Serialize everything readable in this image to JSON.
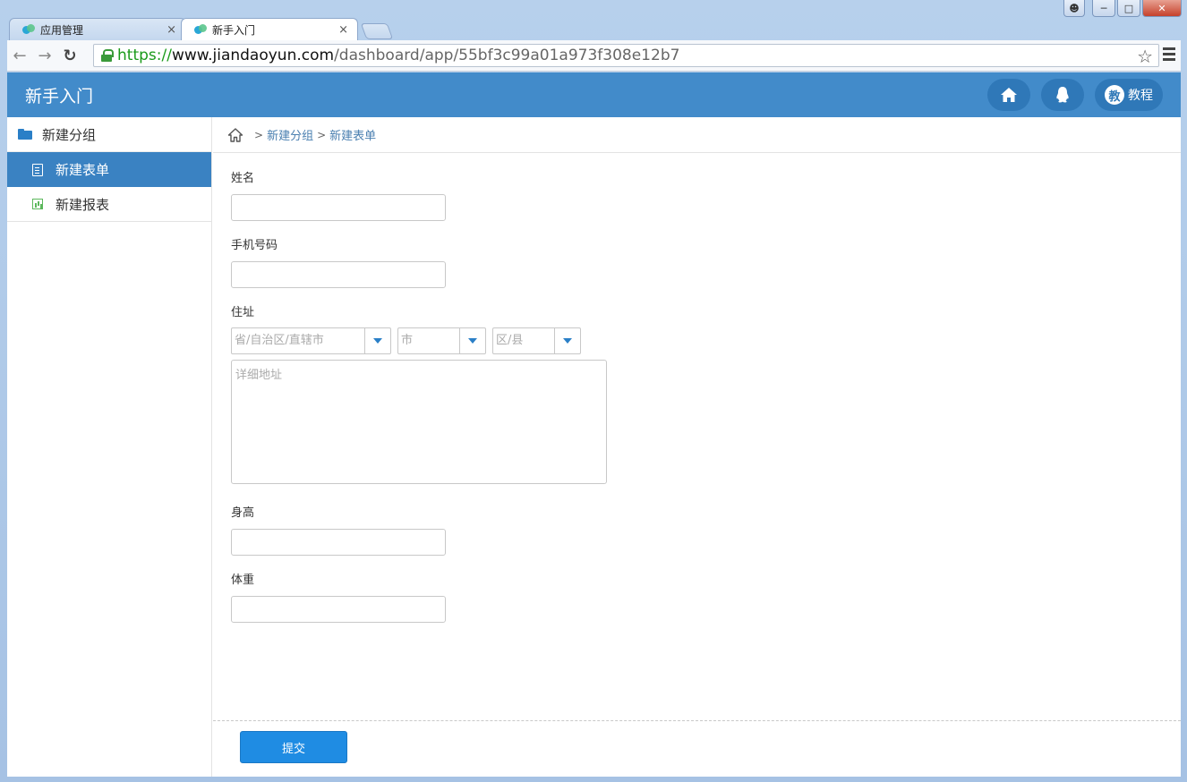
{
  "browser": {
    "tabs": [
      {
        "title": "应用管理",
        "close": "×"
      },
      {
        "title": "新手入门",
        "close": "×"
      }
    ],
    "url": {
      "scheme": "https://",
      "host": "www.jiandaoyun.com",
      "path": "/dashboard/app/55bf3c99a01a973f308e12b7"
    }
  },
  "header": {
    "title": "新手入门",
    "tutorial_badge": "教",
    "tutorial_label": "教程"
  },
  "sidebar": {
    "group_label": "新建分组",
    "items": [
      {
        "label": "新建表单",
        "active": true
      },
      {
        "label": "新建报表",
        "active": false
      }
    ]
  },
  "breadcrumb": {
    "sep": ">",
    "items": [
      "新建分组",
      "新建表单"
    ]
  },
  "form": {
    "name_label": "姓名",
    "phone_label": "手机号码",
    "address": {
      "label": "住址",
      "province_placeholder": "省/自治区/直辖市",
      "city_placeholder": "市",
      "district_placeholder": "区/县",
      "detail_placeholder": "详细地址"
    },
    "height_label": "身高",
    "weight_label": "体重",
    "submit_label": "提交"
  },
  "colors": {
    "header_bg": "#428bca",
    "sidebar_active": "#3a82c2",
    "submit_bg": "#1f8ce3"
  }
}
